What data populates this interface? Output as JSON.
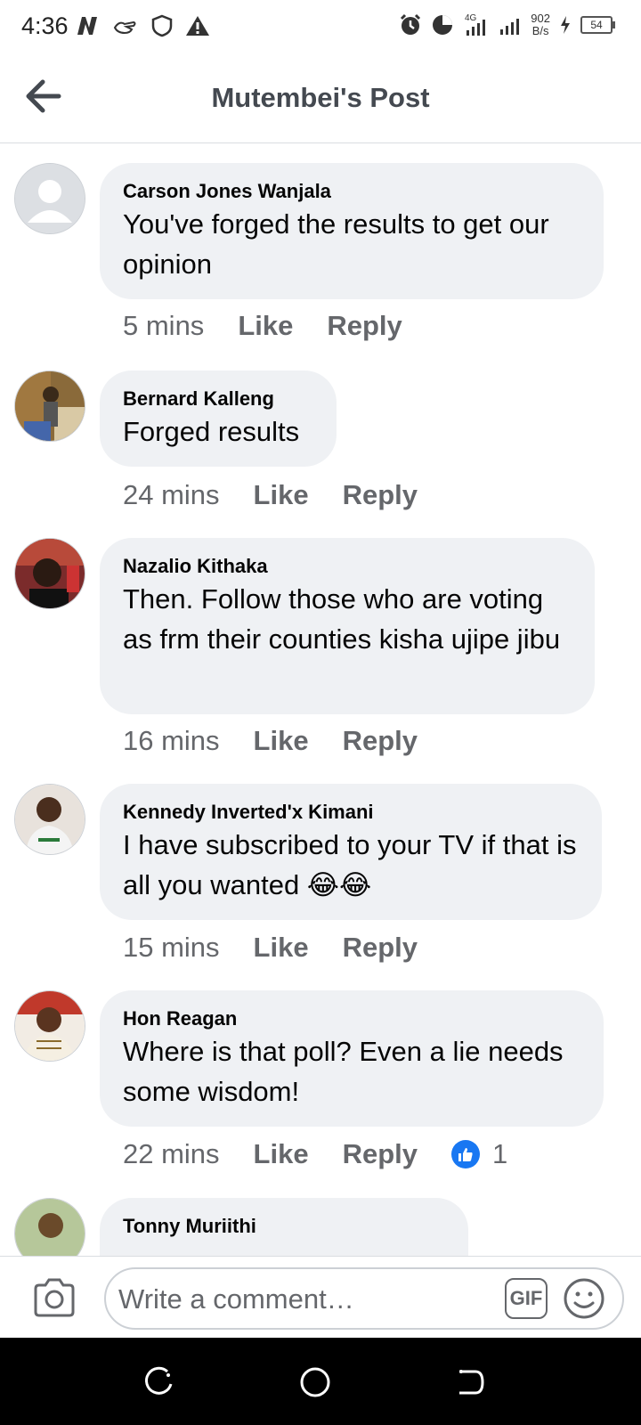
{
  "status_bar": {
    "time": "4:36",
    "network_speed_value": "902",
    "network_speed_unit": "B/s",
    "network_type": "4G",
    "battery_level": "54"
  },
  "header": {
    "title": "Mutembei's Post"
  },
  "comments": [
    {
      "author": "Carson Jones Wanjala",
      "text": "You've forged the results to get our opinion",
      "time": "5 mins",
      "like_label": "Like",
      "reply_label": "Reply"
    },
    {
      "author": "Bernard Kalleng",
      "text": "Forged results",
      "time": "24 mins",
      "like_label": "Like",
      "reply_label": "Reply"
    },
    {
      "author": "Nazalio Kithaka",
      "text": "Then. Follow those who are voting as frm their counties kisha ujipe jibu",
      "time": "16 mins",
      "like_label": "Like",
      "reply_label": "Reply"
    },
    {
      "author": "Kennedy Inverted'x Kimani",
      "text": "I have subscribed to your TV if that is all you wanted 😂😂",
      "time": "15 mins",
      "like_label": "Like",
      "reply_label": "Reply"
    },
    {
      "author": "Hon Reagan",
      "text": "Where is that poll? Even a lie needs some wisdom!",
      "time": "22 mins",
      "like_label": "Like",
      "reply_label": "Reply",
      "reaction_count": "1"
    },
    {
      "author": "Tonny Muriithi"
    }
  ],
  "composer": {
    "placeholder": "Write a comment…",
    "gif_label": "GIF"
  },
  "colors": {
    "accent": "#1877f2",
    "bubble": "#eff1f4",
    "meta_text": "#65676b"
  }
}
